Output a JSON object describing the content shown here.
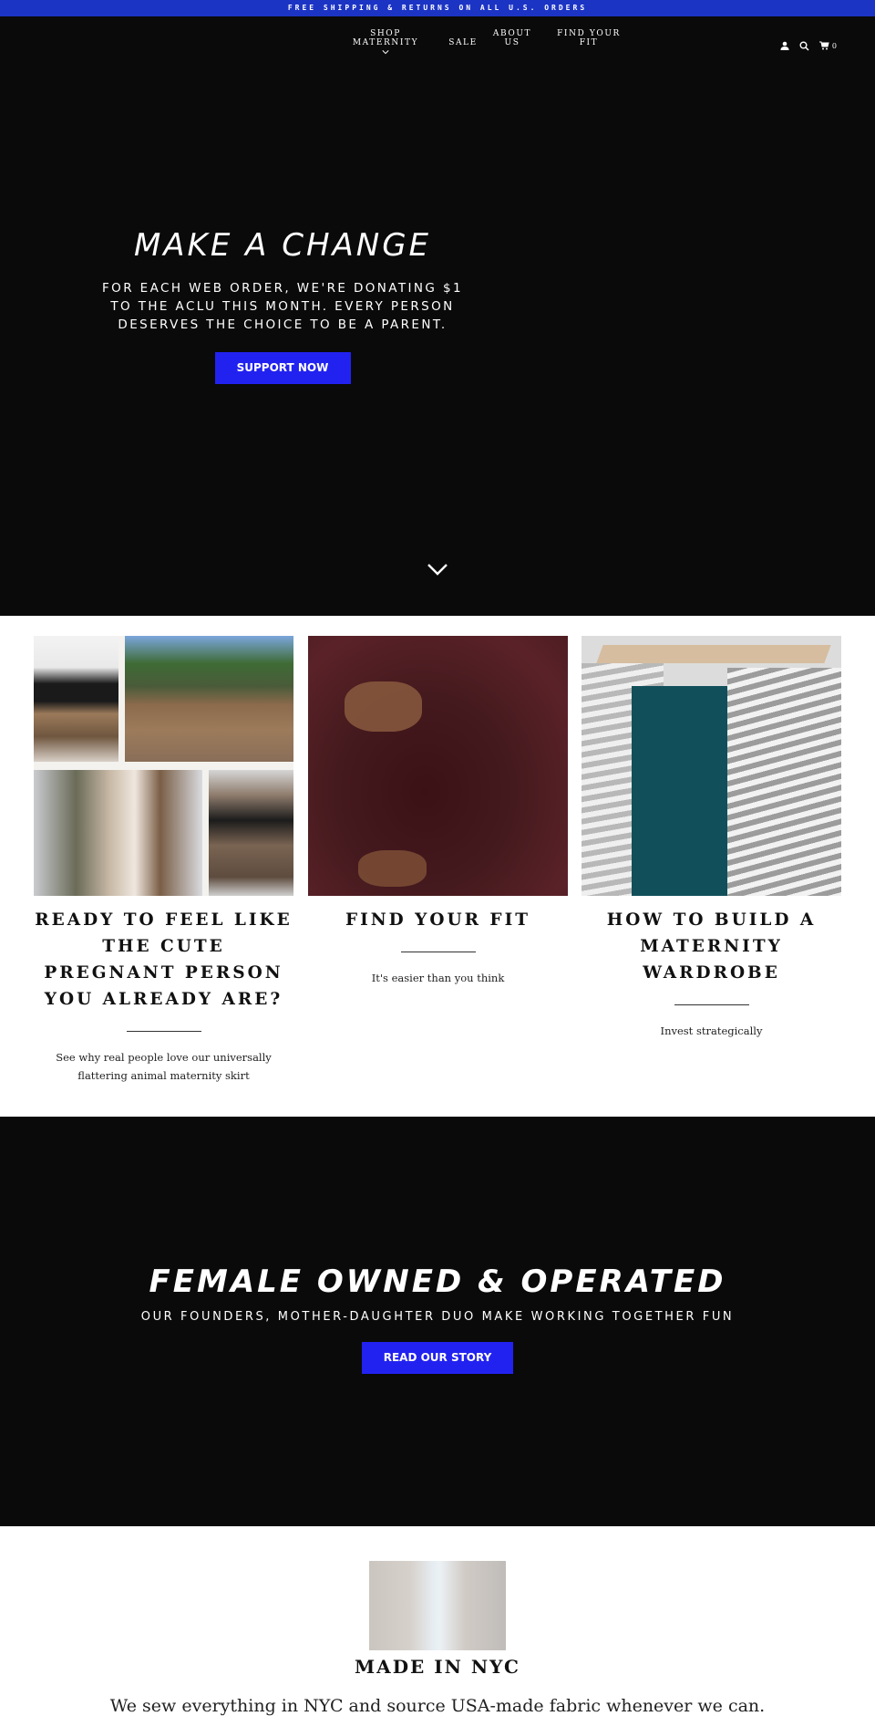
{
  "announcement": "FREE SHIPPING & RETURNS ON ALL U.S. ORDERS",
  "nav": {
    "items": [
      {
        "label": "SHOP MATERNITY",
        "has_dropdown": true
      },
      {
        "label": "SALE"
      },
      {
        "label": "ABOUT US"
      },
      {
        "label": "FIND YOUR FIT"
      }
    ],
    "icons": [
      "user-icon",
      "search-icon",
      "cart-icon"
    ],
    "cart_count": "0"
  },
  "hero": {
    "title": "MAKE A CHANGE",
    "subtitle": "FOR EACH WEB ORDER, WE'RE DONATING $1 TO THE ACLU THIS MONTH. EVERY PERSON DESERVES THE CHOICE TO BE A PARENT.",
    "button": "SUPPORT NOW"
  },
  "cards": [
    {
      "title": "READY TO FEEL LIKE THE CUTE PREGNANT PERSON YOU ALREADY ARE?",
      "description": "See why real people love our universally flattering animal maternity skirt",
      "image": "collage of people wearing leopard maternity skirt"
    },
    {
      "title": "FIND YOUR FIT",
      "description": "It's easier than you think",
      "image": "pregnant woman in burgundy ruched dress"
    },
    {
      "title": "HOW TO BUILD A MATERNITY WARDROBE",
      "description": "Invest strategically",
      "image": "tops on wooden hangers"
    }
  ],
  "story": {
    "title": "FEMALE OWNED & OPERATED",
    "subtitle": "OUR FOUNDERS, MOTHER-DAUGHTER DUO MAKE WORKING TOGETHER FUN",
    "button": "READ OUR STORY"
  },
  "nyc": {
    "title": "MADE IN NYC",
    "description": "We sew everything in NYC and source USA-made fabric whenever we can."
  },
  "colors": {
    "announcement_bg": "#1c34c4",
    "dark_bg": "#0a0a0a",
    "button_bg": "#2222f0"
  }
}
